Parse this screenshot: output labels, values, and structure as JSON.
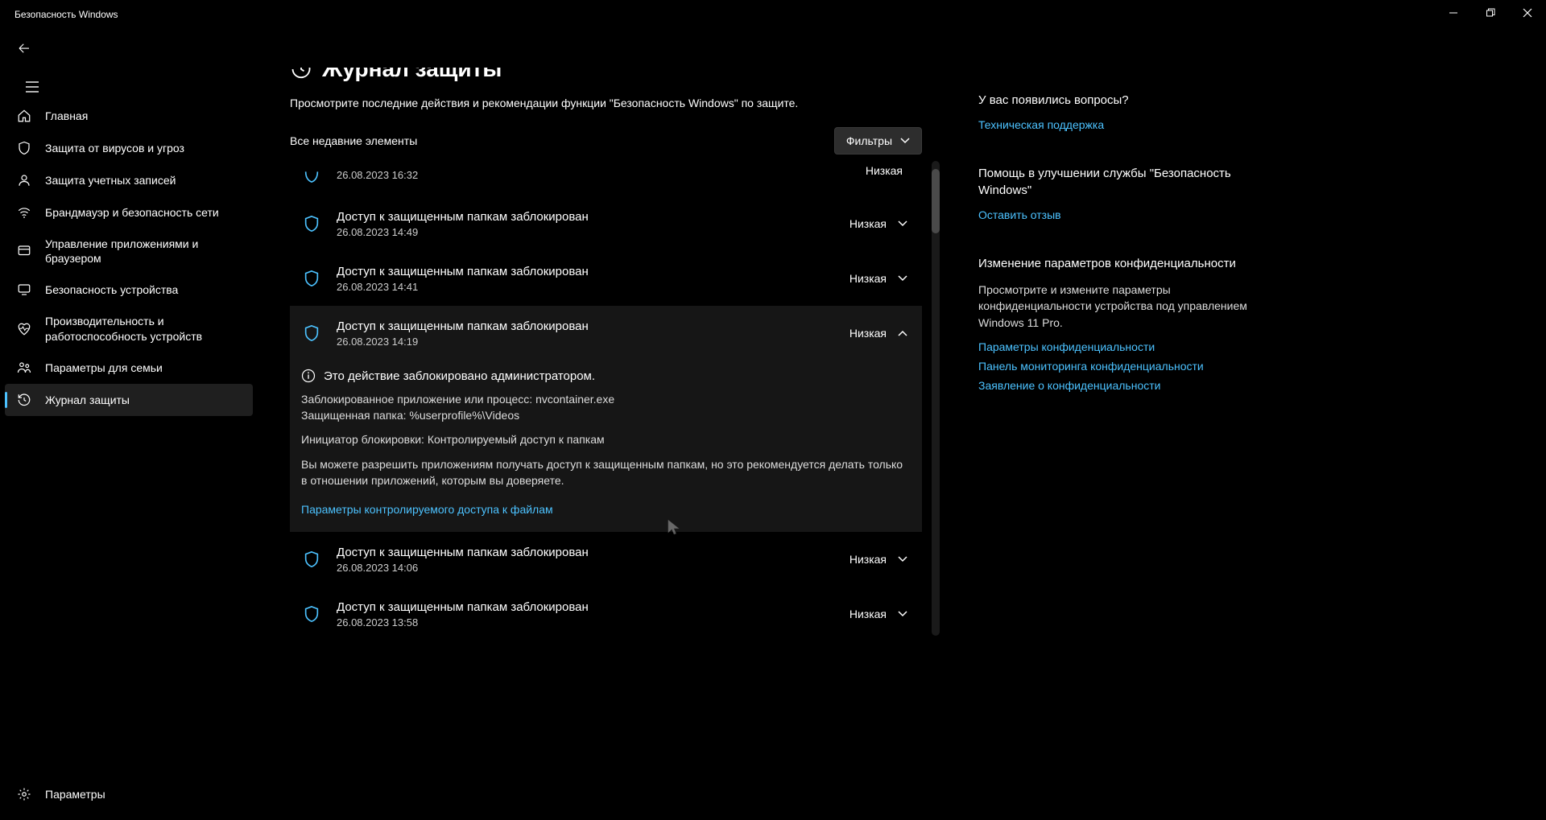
{
  "window": {
    "title": "Безопасность Windows"
  },
  "sidebar": {
    "items": [
      {
        "label": "Главная"
      },
      {
        "label": "Защита от вирусов и угроз"
      },
      {
        "label": "Защита учетных записей"
      },
      {
        "label": "Брандмауэр и безопасность сети"
      },
      {
        "label": "Управление приложениями и браузером"
      },
      {
        "label": "Безопасность устройства"
      },
      {
        "label": "Производительность и работоспособность устройств"
      },
      {
        "label": "Параметры для семьи"
      },
      {
        "label": "Журнал защиты"
      }
    ],
    "settings": "Параметры"
  },
  "page": {
    "title": "Журнал защиты",
    "subtitle": "Просмотрите последние действия и рекомендации функции \"Безопасность Windows\" по защите.",
    "list_label": "Все недавние элементы",
    "filters_label": "Фильтры"
  },
  "events": [
    {
      "title": "",
      "time": "26.08.2023 16:32",
      "severity": "Низкая",
      "partial": true
    },
    {
      "title": "Доступ к защищенным папкам заблокирован",
      "time": "26.08.2023 14:49",
      "severity": "Низкая"
    },
    {
      "title": "Доступ к защищенным папкам заблокирован",
      "time": "26.08.2023 14:41",
      "severity": "Низкая"
    },
    {
      "title": "Доступ к защищенным папкам заблокирован",
      "time": "26.08.2023 14:19",
      "severity": "Низкая",
      "expanded": true
    },
    {
      "title": "Доступ к защищенным папкам заблокирован",
      "time": "26.08.2023 14:06",
      "severity": "Низкая"
    },
    {
      "title": "Доступ к защищенным папкам заблокирован",
      "time": "26.08.2023 13:58",
      "severity": "Низкая"
    }
  ],
  "detail": {
    "admin_block": "Это действие заблокировано администратором.",
    "blocked_app_label": "Заблокированное приложение или процесс:",
    "blocked_app_value": "nvcontainer.exe",
    "protected_folder_label": "Защищенная папка:",
    "protected_folder_value": "%userprofile%\\Videos",
    "initiator_label": "Инициатор блокировки:",
    "initiator_value": "Контролируемый доступ к папкам",
    "note": "Вы можете разрешить приложениям получать доступ к защищенным папкам, но это рекомендуется делать только в отношении приложений, которым вы доверяете.",
    "link": "Параметры контролируемого доступа к файлам"
  },
  "right": {
    "q_title": "У вас появились вопросы?",
    "q_link": "Техническая поддержка",
    "help_title": "Помощь в улучшении службы \"Безопасность Windows\"",
    "help_link": "Оставить отзыв",
    "priv_title": "Изменение параметров конфиденциальности",
    "priv_text": "Просмотрите и измените параметры конфиденциальности устройства под управлением Windows 11 Pro.",
    "priv_link1": "Параметры конфиденциальности",
    "priv_link2": "Панель мониторинга конфиденциальности",
    "priv_link3": "Заявление о конфиденциальности"
  }
}
